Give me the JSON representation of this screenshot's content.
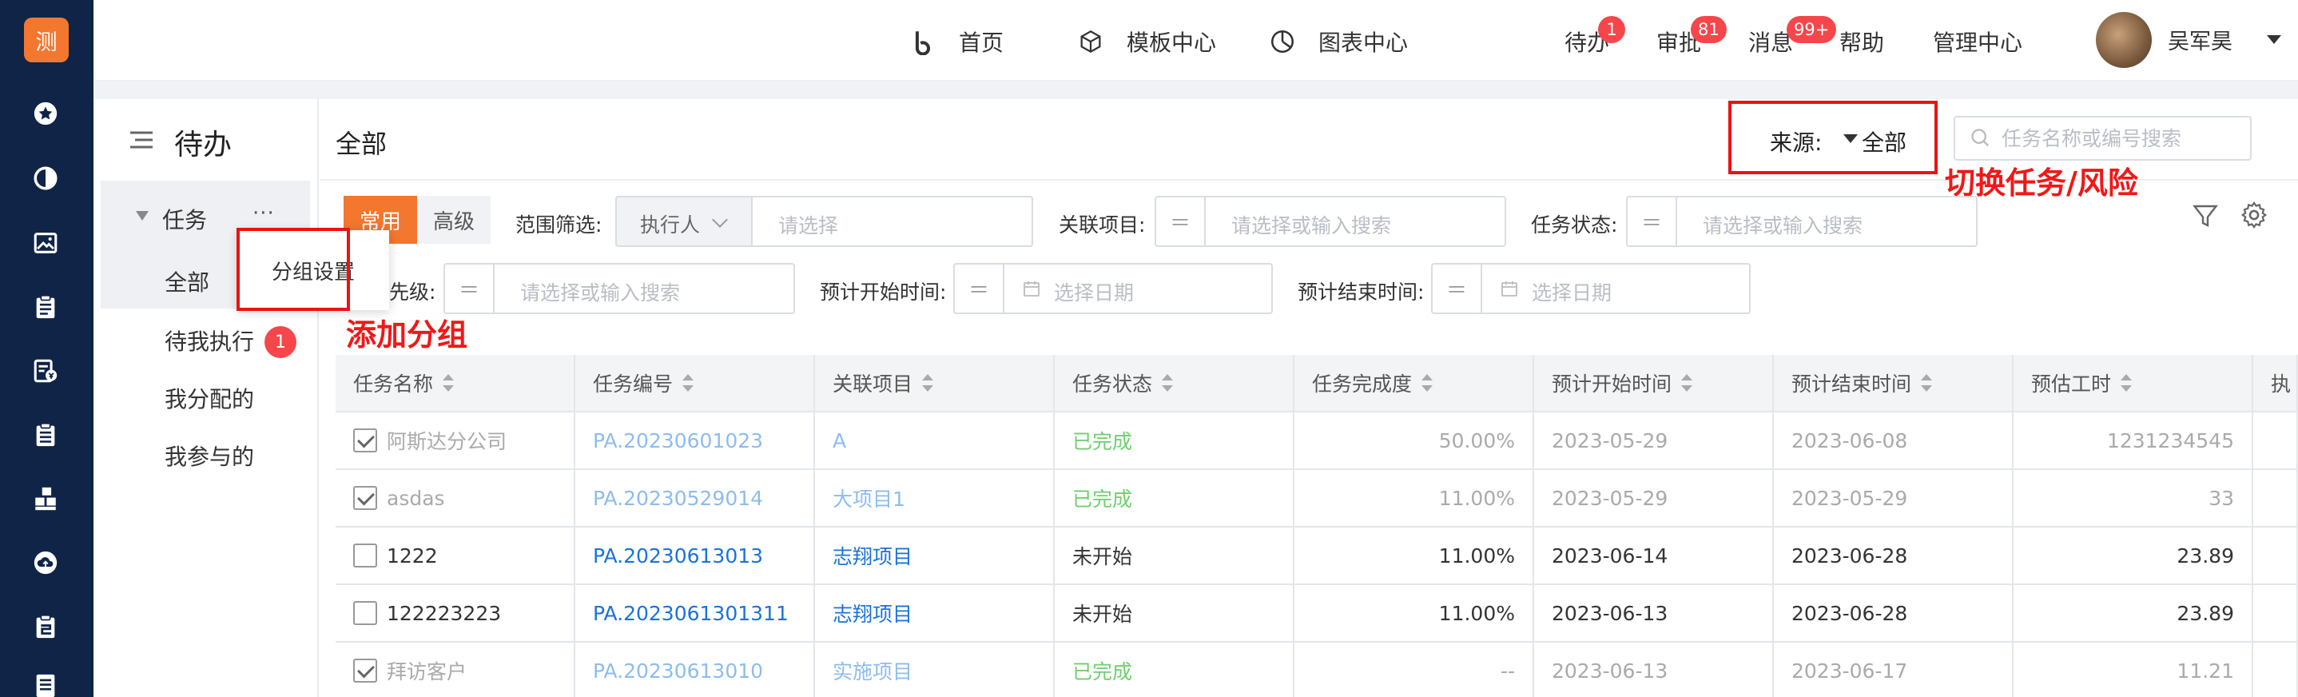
{
  "app": {
    "logo_char": "测"
  },
  "rail": {
    "icons": [
      "star-icon",
      "pie-chart-icon",
      "image-icon",
      "clipboard-icon",
      "money-document-icon",
      "checklist-icon",
      "blocks-icon",
      "cloud-upload-icon",
      "edit-clipboard-icon",
      "document-icon"
    ]
  },
  "topnav": {
    "home": "首页",
    "templates": "模板中心",
    "charts": "图表中心",
    "todo": "待办",
    "todo_badge": "1",
    "approve": "审批",
    "approve_badge": "81",
    "messages": "消息",
    "messages_badge": "99+",
    "help": "帮助",
    "admin": "管理中心",
    "user_name": "吴军昊"
  },
  "sidebar": {
    "title": "待办",
    "group": "任务",
    "more": "···",
    "items": [
      {
        "label": "全部"
      },
      {
        "label": "待我执行",
        "badge": "1"
      },
      {
        "label": "我分配的"
      },
      {
        "label": "我参与的"
      }
    ],
    "popup_item": "分组设置"
  },
  "annotations": {
    "add_group": "添加分组",
    "switch_source": "切换任务/风险"
  },
  "main": {
    "title": "全部",
    "source_label": "来源:",
    "source_value": "全部",
    "search_placeholder": "任务名称或编号搜索"
  },
  "filters": {
    "tab_common": "常用",
    "tab_advanced": "高级",
    "scope_label": "范围筛选:",
    "executor": "执行人",
    "select_placeholder": "请选择",
    "project_label": "关联项目:",
    "status_label": "任务状态:",
    "search_placeholder": "请选择或输入搜索",
    "priority_label": "优先级:",
    "start_label": "预计开始时间:",
    "end_label": "预计结束时间:",
    "date_placeholder": "选择日期"
  },
  "table": {
    "headers": [
      "任务名称",
      "任务编号",
      "关联项目",
      "任务状态",
      "任务完成度",
      "预计开始时间",
      "预计结束时间",
      "预估工时",
      "执"
    ],
    "rows": [
      {
        "checked": true,
        "name": "阿斯达分公司",
        "code": "PA.20230601023",
        "project": "A",
        "status": "已完成",
        "progress": "50.00%",
        "start": "2023-05-29",
        "end": "2023-06-08",
        "hours": "1231234545",
        "done": true
      },
      {
        "checked": true,
        "name": "asdas",
        "code": "PA.20230529014",
        "project": "大项目1",
        "status": "已完成",
        "progress": "11.00%",
        "start": "2023-05-29",
        "end": "2023-05-29",
        "hours": "33",
        "done": true
      },
      {
        "checked": false,
        "name": "1222",
        "code": "PA.20230613013",
        "project": "志翔项目",
        "status": "未开始",
        "progress": "11.00%",
        "start": "2023-06-14",
        "end": "2023-06-28",
        "hours": "23.89",
        "done": false
      },
      {
        "checked": false,
        "name": "122223223",
        "code": "PA.2023061301311",
        "project": "志翔项目",
        "status": "未开始",
        "progress": "11.00%",
        "start": "2023-06-13",
        "end": "2023-06-28",
        "hours": "23.89",
        "done": false
      },
      {
        "checked": true,
        "name": "拜访客户",
        "code": "PA.20230613010",
        "project": "实施项目",
        "status": "已完成",
        "progress": "--",
        "start": "2023-06-13",
        "end": "2023-06-17",
        "hours": "11.21",
        "done": true
      }
    ]
  }
}
